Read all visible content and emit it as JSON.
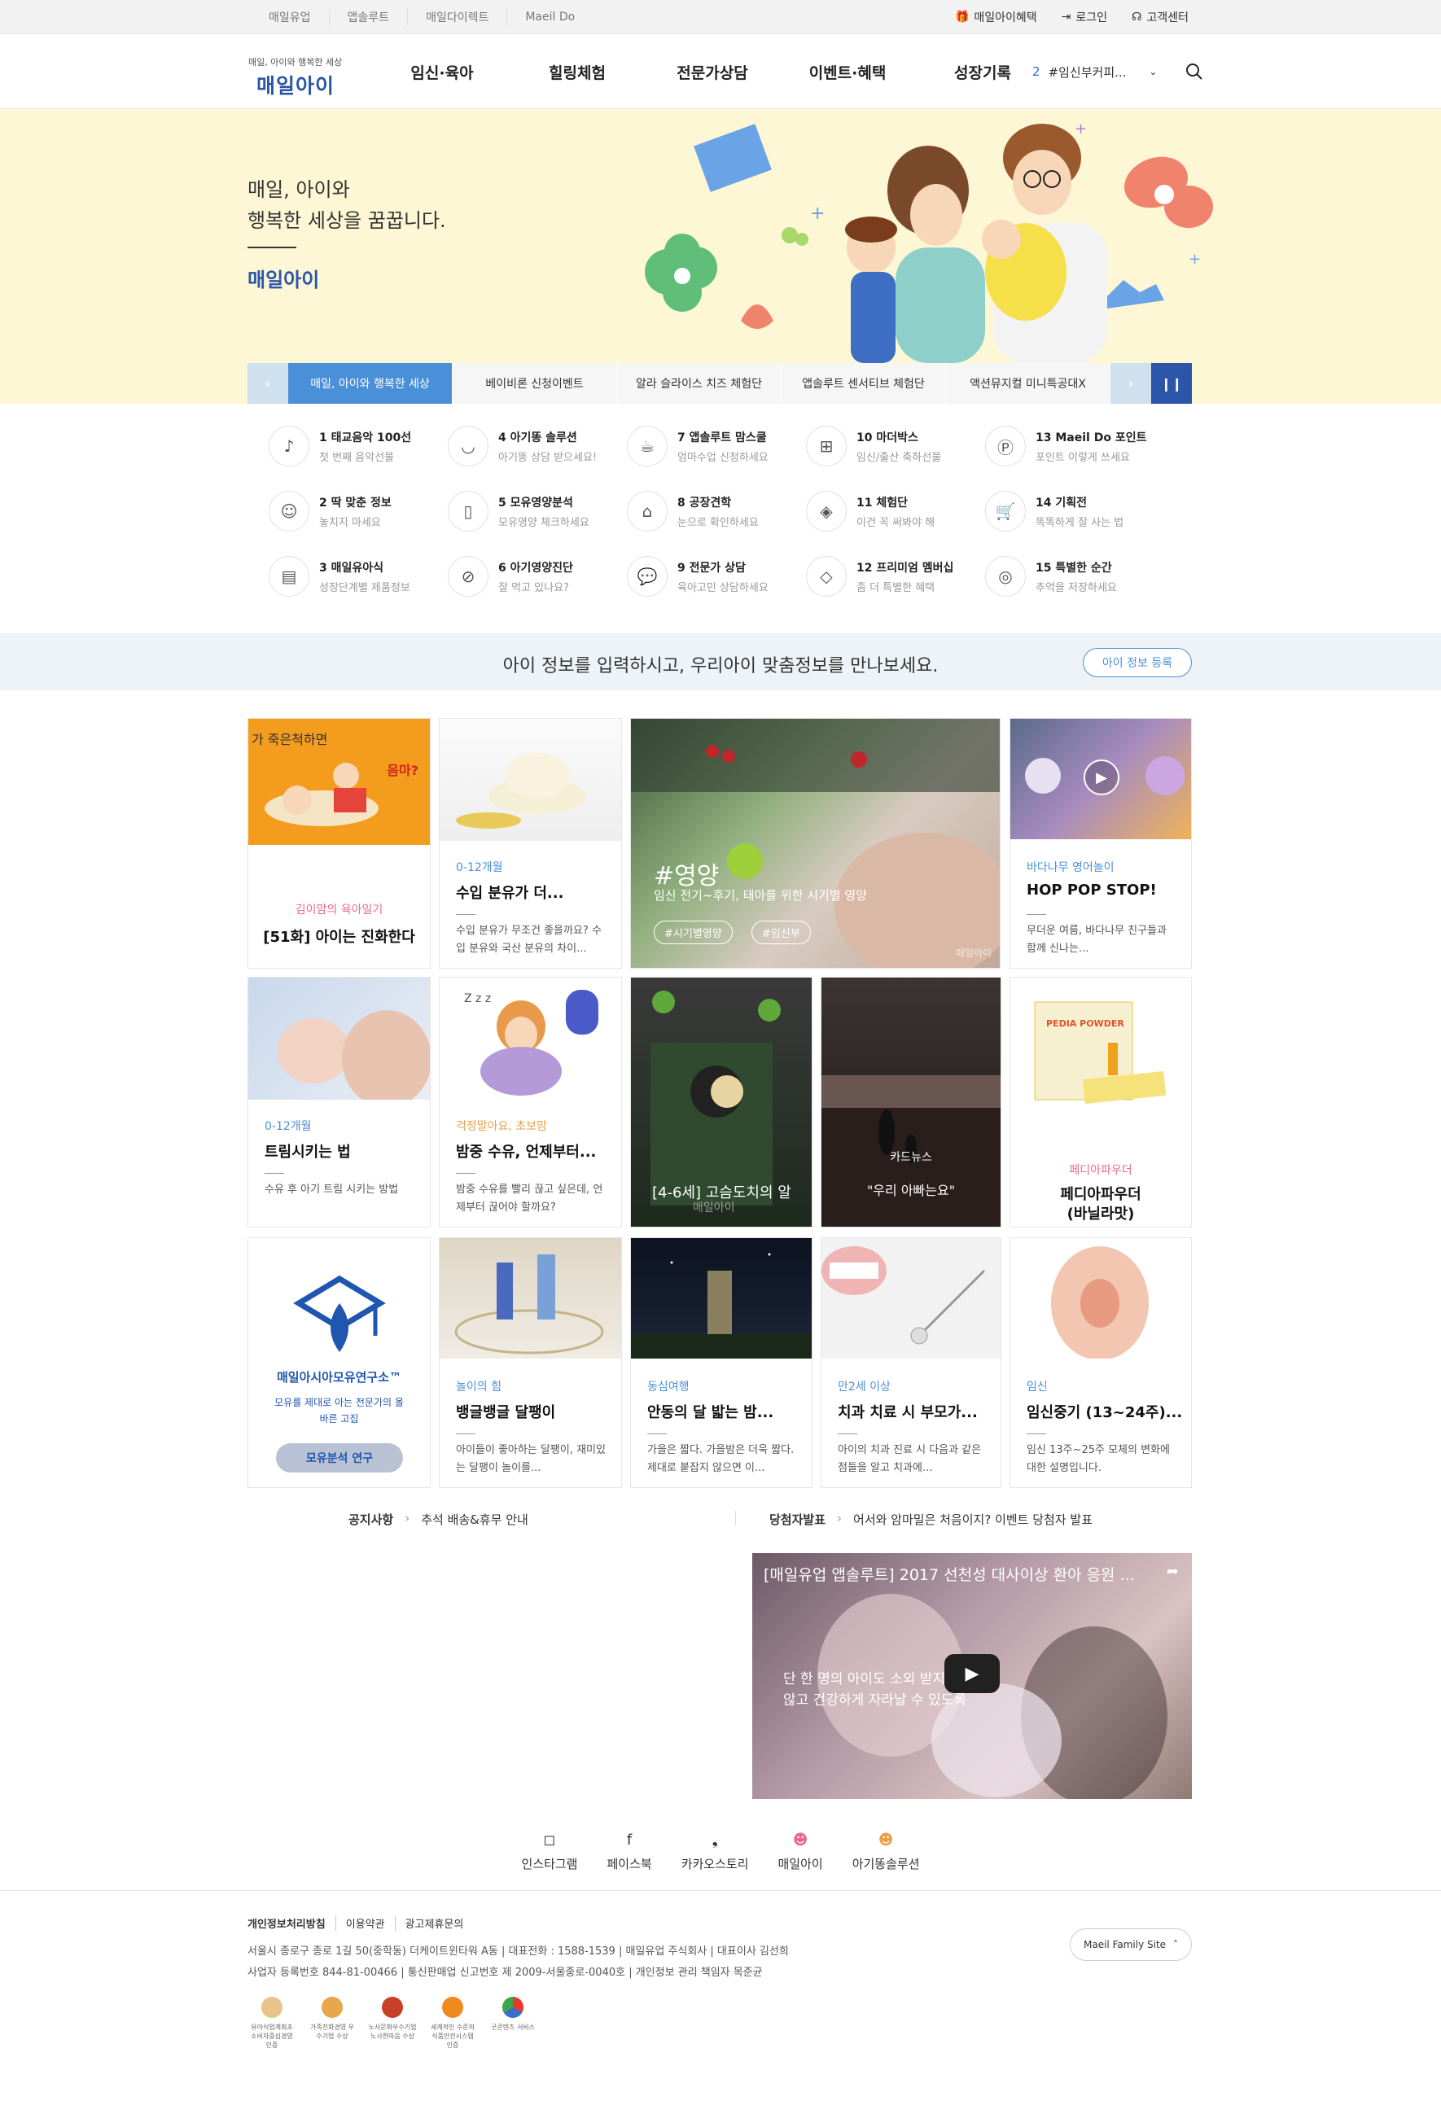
{
  "topbar": {
    "links": [
      "매일유업",
      "앱솔루트",
      "매일다이렉트",
      "Maeil Do"
    ],
    "right": [
      {
        "icon": "gift-icon",
        "label": "매일아이혜택"
      },
      {
        "icon": "login-icon",
        "label": "로그인"
      },
      {
        "icon": "headset-icon",
        "label": "고객센터"
      }
    ]
  },
  "header": {
    "logo_sub": "매일, 아이와 행복한 세상",
    "logo": "매일아이",
    "nav": [
      "임신·육아",
      "힐링체험",
      "전문가상담",
      "이벤트·혜택",
      "성장기록"
    ],
    "search_rank": "2",
    "search_text": "#임신부커피..."
  },
  "hero": {
    "line1": "매일, 아이와",
    "line2": "행복한 세상을 꿈꿉니다.",
    "brand": "매일아이",
    "tabs": [
      "매일, 아이와 행복한 세상",
      "베이비론 신청이벤트",
      "알라 슬라이스 치즈 체험단",
      "앱솔루트 센서티브 체험단",
      "액션뮤지컬 미니특공대X"
    ]
  },
  "services": [
    {
      "title": "1 태교음악 100선",
      "sub": "첫 번째 음악선물",
      "icon": "music-icon"
    },
    {
      "title": "4 아기똥 솔루션",
      "sub": "아기똥 상담 받으세요!",
      "icon": "diaper-icon"
    },
    {
      "title": "7 앱솔루트 맘스쿨",
      "sub": "엄마수업 신청하세요",
      "icon": "cup-icon"
    },
    {
      "title": "10 마더박스",
      "sub": "임신/출산 축하선물",
      "icon": "gift-icon"
    },
    {
      "title": "13 Maeil Do 포인트",
      "sub": "포인트 이렇게 쓰세요",
      "icon": "point-icon"
    },
    {
      "title": "2 딱 맞춘 정보",
      "sub": "놓치지 마세요",
      "icon": "baby-icon"
    },
    {
      "title": "5 모유영양분석",
      "sub": "모유영양 체크하세요",
      "icon": "tube-icon"
    },
    {
      "title": "8 공장견학",
      "sub": "눈으로 확인하세요",
      "icon": "factory-icon"
    },
    {
      "title": "11 체험단",
      "sub": "이건 꼭 써봐야 해",
      "icon": "box-icon"
    },
    {
      "title": "14 기획전",
      "sub": "똑똑하게 잘 사는 법",
      "icon": "cart-icon"
    },
    {
      "title": "3 매일유아식",
      "sub": "성장단계별 제품정보",
      "icon": "food-icon"
    },
    {
      "title": "6 아기영양진단",
      "sub": "잘 먹고 있나요?",
      "icon": "bottle-icon"
    },
    {
      "title": "9 전문가 상담",
      "sub": "육아고민 상담하세요",
      "icon": "chat-icon"
    },
    {
      "title": "12 프리미엄 멤버십",
      "sub": "좀 더 특별한 혜택",
      "icon": "diamond-icon"
    },
    {
      "title": "15 특별한 순간",
      "sub": "추억을 저장하세요",
      "icon": "camera-icon"
    }
  ],
  "band": {
    "text": "아이 정보를 입력하시고, 우리아이 맞춤정보를 만나보세요.",
    "button": "아이 정보 등록"
  },
  "cards": {
    "c1": {
      "cat": "김이맘의 육아일기",
      "title": "[51화] 아이는 진화한다",
      "img_text": "가 죽은척하면",
      "img_text2": "음마?"
    },
    "c2": {
      "cat": "0-12개월",
      "title": "수입 분유가 더...",
      "desc": "수입 분유가 무조건 좋을까요? 수입 분유와 국산 분유의 차이..."
    },
    "c3": {
      "tag": "#영양",
      "sub": "임신 전기~후기, 태아를 위한 시기별 영양",
      "chips": [
        "#시기별영양",
        "#임신부"
      ],
      "mark": "매일아이"
    },
    "c4": {
      "cat": "바다나무 영어놀이",
      "title": "HOP POP STOP!",
      "desc": "무더운 여름, 바다나무 친구들과 함께 신나는..."
    },
    "c5": {
      "cat": "0-12개월",
      "title": "트림시키는 법",
      "desc": "수유 후 아기 트림 시키는 방법"
    },
    "c6": {
      "cat": "걱정말아요, 초보맘",
      "title": "밤중 수유, 언제부터...",
      "desc": "밤중 수유를 빨리 끊고 싶은데, 언제부터 끊어야 할까요?"
    },
    "c7": {
      "title": "[4-6세] 고슴도치의 알",
      "mark": "매일아이"
    },
    "c8": {
      "cat": "카드뉴스",
      "title": "\"우리 아빠는요\""
    },
    "c9": {
      "cat": "페디아파우더",
      "title": "페디아파우더",
      "title2": "(바닐라맛)",
      "box": "PEDIA POWDER"
    },
    "c10": {
      "title": "매일아시아모유연구소™",
      "desc": "모유를 제대로 아는 전문가의 올바른 고집",
      "button": "모유분석 연구"
    },
    "c11": {
      "cat": "놀이의 힘",
      "title": "뱅글뱅글 달팽이",
      "desc": "아이들이 좋아하는 달팽이, 재미있는 달팽이 놀이를..."
    },
    "c12": {
      "cat": "동심여행",
      "title": "안동의 달 밟는 밤...",
      "desc": "가을은 짧다. 가을밤은 더욱 짧다. 제대로 붙잡지 않으면 이..."
    },
    "c13": {
      "cat": "만2세 이상",
      "title": "치과 치료 시 부모가...",
      "desc": "아이의 치과 진료 시 다음과 같은 점들을 알고 치과에..."
    },
    "c14": {
      "cat": "임신",
      "title": "임신중기 (13~24주)...",
      "desc": "임신 13주~25주 모체의 변화에 대한 설명입니다."
    }
  },
  "notice": {
    "label": "공지사항",
    "text": "추석 배송&휴무 안내",
    "winner_label": "당첨자발표",
    "winner_text": "어서와 암마밀은 처음이지? 이벤트 당첨자 발표"
  },
  "video": {
    "title": "[매일유업 앱솔루트] 2017 선천성 대사이상 환아 응원 ...",
    "sub1": "단 한 명의 아이도 소외 받지",
    "sub2": "않고 건강하게 자라날 수 있도록"
  },
  "sns": [
    "인스타그램",
    "페이스북",
    "카카오스토리",
    "매일아이",
    "아기똥솔루션"
  ],
  "footer": {
    "links": [
      "개인정보처리방침",
      "이용약관",
      "광고제휴문의"
    ],
    "addr1": "서울시 종로구 종로 1길 50(중학동) 더케이트윈타워 A동  |  대표전화 : 1588-1539  |  매일유업 주식회사  |  대표이사 김선희",
    "addr2": "사업자 등록번호 844-81-00466  |  통신판매업 신고번호 제 2009-서울종로-0040호  |  개인정보 관리 책임자 목준균",
    "family": "Maeil Family Site",
    "certs": [
      "유아식업계최초 소비자중심경영 인증",
      "가족친화경영 우수기업 수상",
      "노사문화우수기업 노사한마음 수상",
      "세계적인 수준의 식품안전시스템 인증",
      "굿콘텐츠 서비스"
    ],
    "cert_colors": [
      "#e8c38a",
      "#e6a84a",
      "#c8402a",
      "#f08a1c",
      "#3a6ec8"
    ]
  },
  "colors": {
    "brand": "#2a55a8",
    "accent": "#4a90d8",
    "hero_bg": "#fdf7d6"
  }
}
